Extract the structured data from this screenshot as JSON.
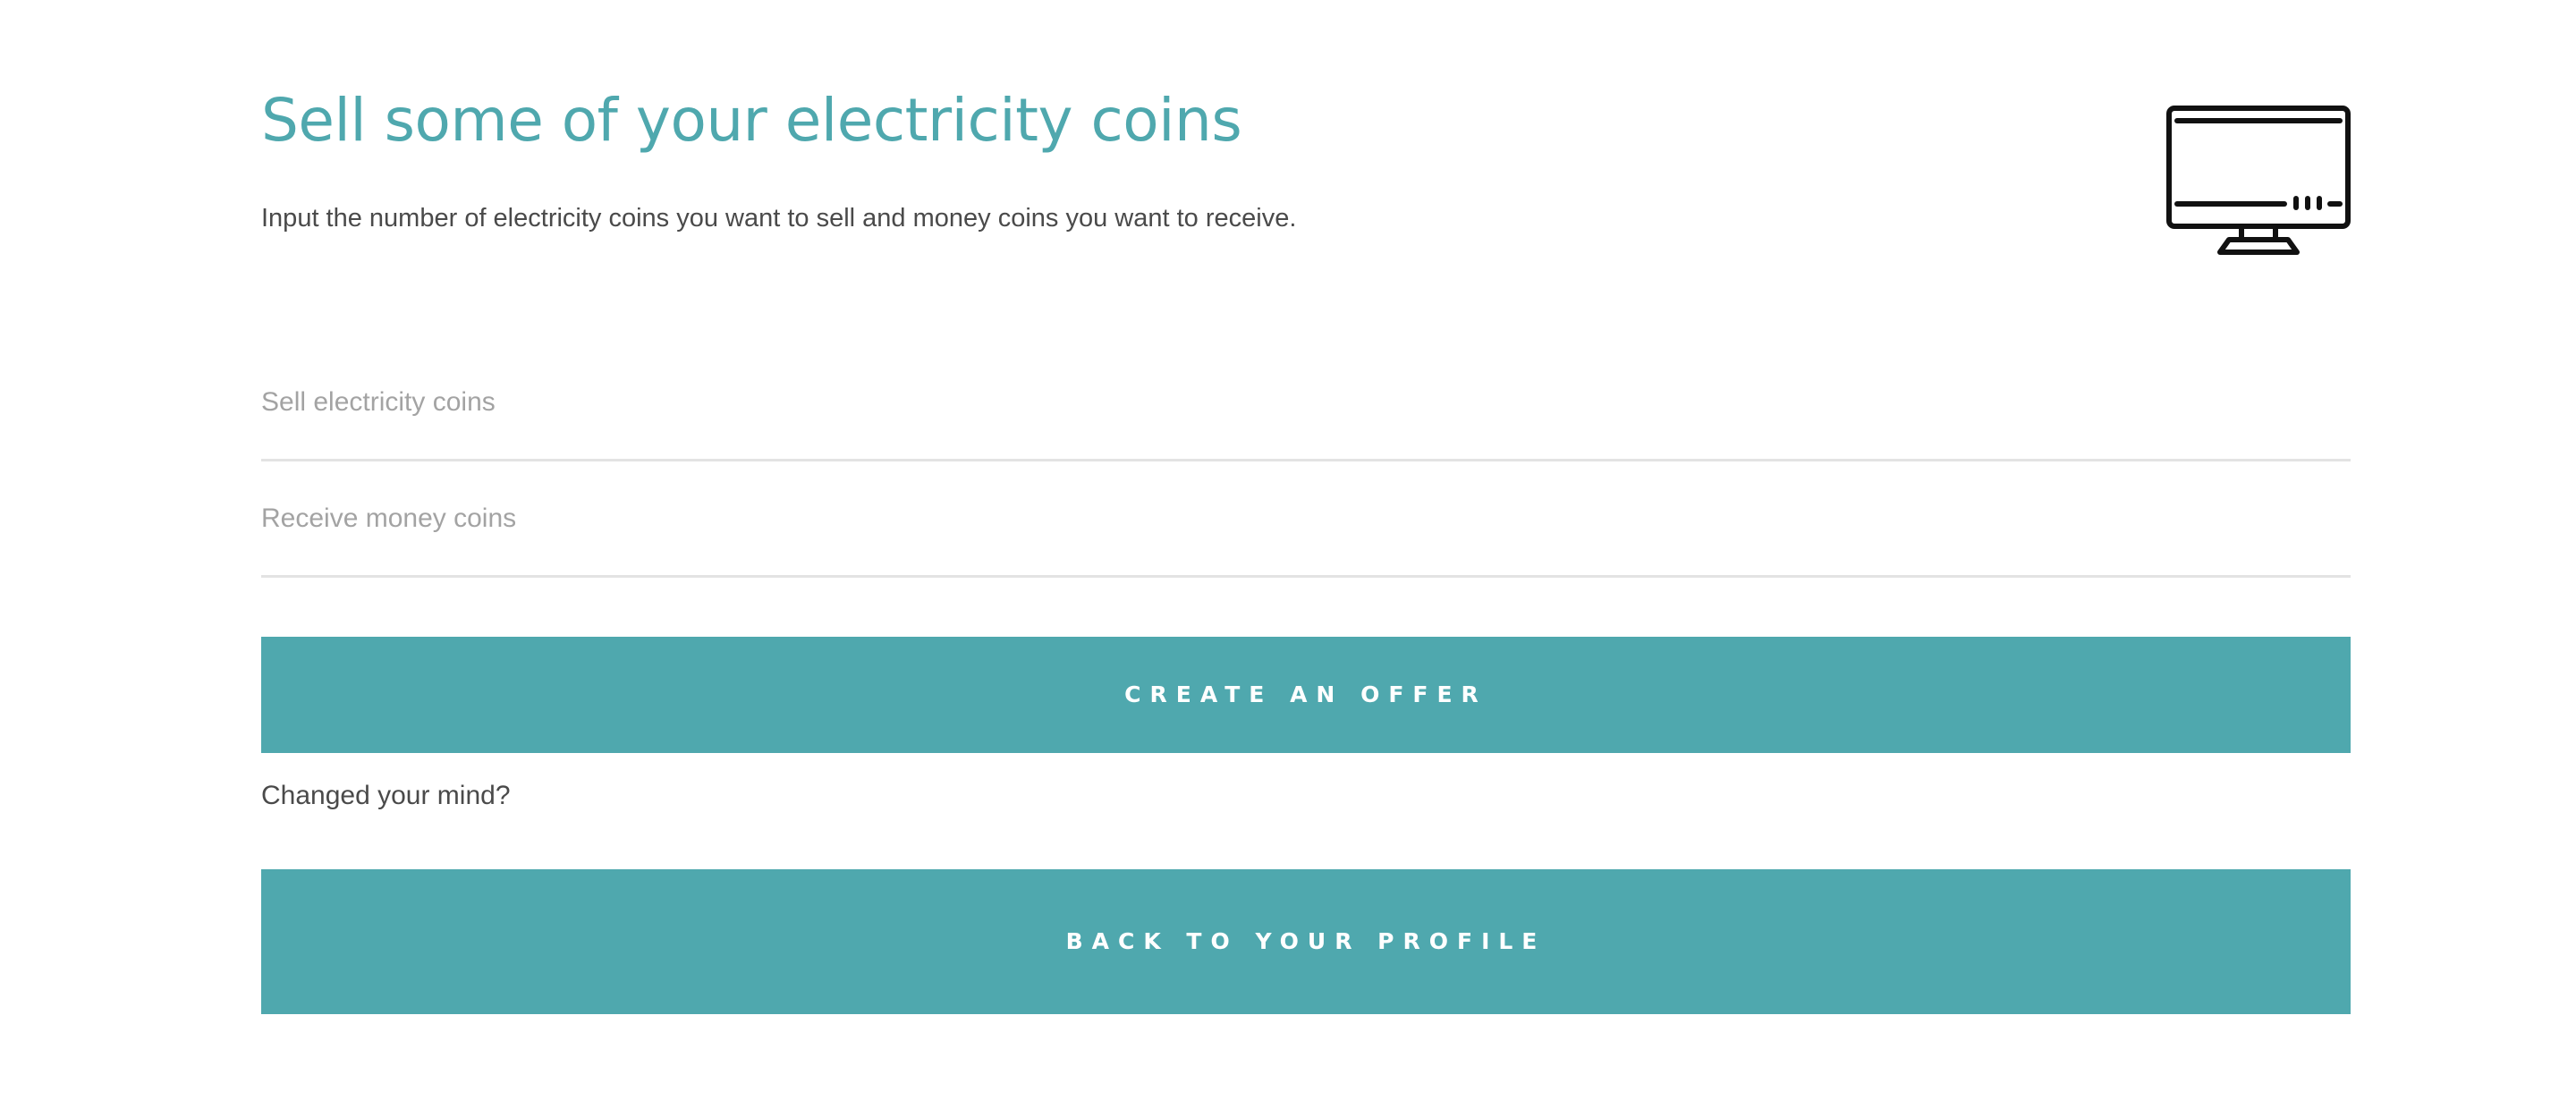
{
  "header": {
    "title": "Sell some of your electricity coins",
    "subtitle": "Input the number of electricity coins you want to sell and money coins you want to receive.",
    "icon": "monitor-icon"
  },
  "form": {
    "sell_placeholder": "Sell electricity coins",
    "sell_value": "",
    "receive_placeholder": "Receive money coins",
    "receive_value": "",
    "create_label": "CREATE AN OFFER"
  },
  "footer": {
    "changed_mind_text": "Changed your mind?",
    "back_label": "BACK TO YOUR PROFILE"
  },
  "colors": {
    "accent": "#4fa8ae",
    "text": "#4a4a4a",
    "placeholder": "#a3a3a3",
    "divider": "#e3e3e3"
  }
}
